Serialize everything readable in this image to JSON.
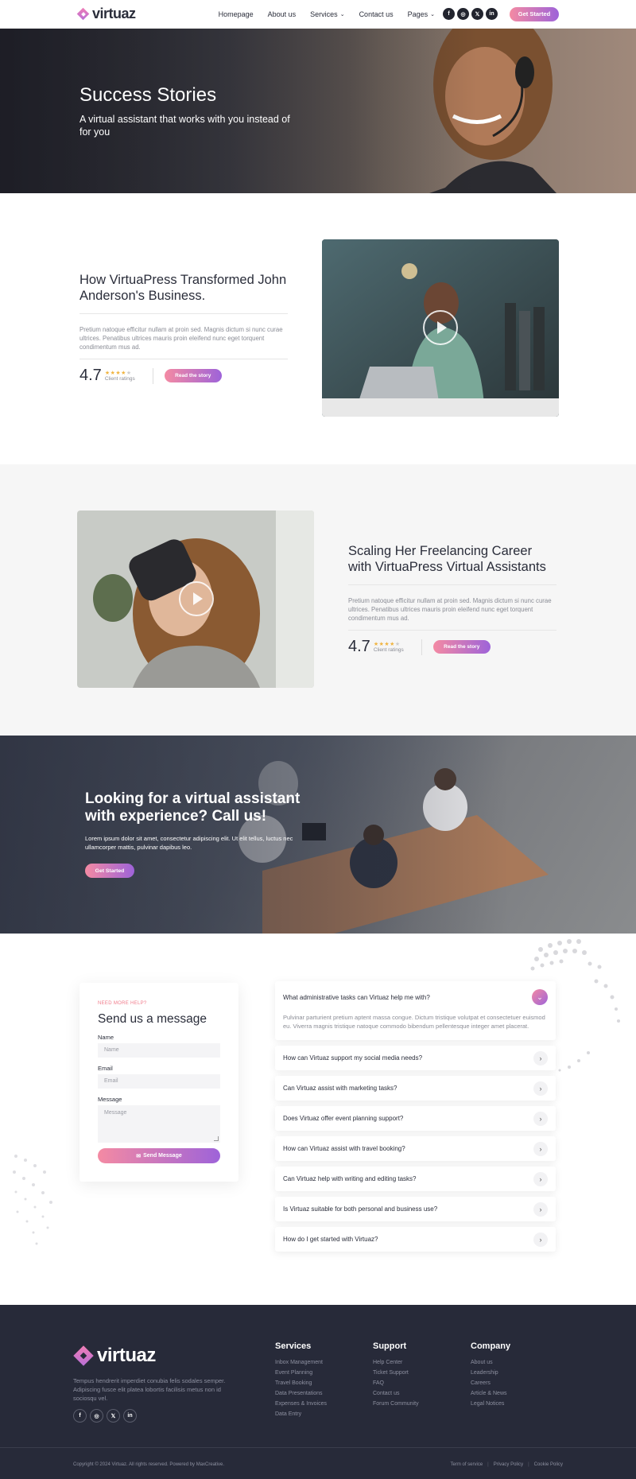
{
  "header": {
    "brand": "virtuaz",
    "nav": [
      {
        "label": "Homepage",
        "has_dropdown": false
      },
      {
        "label": "About us",
        "has_dropdown": false
      },
      {
        "label": "Services",
        "has_dropdown": true
      },
      {
        "label": "Contact us",
        "has_dropdown": false
      },
      {
        "label": "Pages",
        "has_dropdown": true
      }
    ],
    "socials": [
      "f",
      "◎",
      "𝕏",
      "in"
    ],
    "cta_label": "Get Started"
  },
  "hero": {
    "title": "Success Stories",
    "subtitle": "A virtual assistant that works with you instead of for you"
  },
  "stories": [
    {
      "title": "How VirtuaPress Transformed John Anderson's Business.",
      "body": "Pretium natoque efficitur nullam at proin sed. Magnis dictum si nunc curae ultrices. Penatibus ultrices mauris proin eleifend nunc eget torquent condimentum mus ad.",
      "rating": "4.7",
      "stars": "★★★★",
      "stars_off": "★",
      "rating_label": "Client ratings",
      "button": "Read the story"
    },
    {
      "title": "Scaling Her Freelancing Career with VirtuaPress Virtual Assistants",
      "body": "Pretium natoque efficitur nullam at proin sed. Magnis dictum si nunc curae ultrices. Penatibus ultrices mauris proin eleifend nunc eget torquent condimentum mus ad.",
      "rating": "4.7",
      "stars": "★★★★",
      "stars_off": "★",
      "rating_label": "Client ratings",
      "button": "Read the story"
    }
  ],
  "cta": {
    "title": "Looking for a virtual assistant with experience? Call us!",
    "body": "Lorem ipsum dolor sit amet, consectetur adipiscing elit. Ut elit tellus, luctus nec ullamcorper mattis, pulvinar dapibus leo.",
    "button": "Get Started"
  },
  "contact": {
    "eyebrow": "NEED MORE HELP?",
    "title": "Send us a message",
    "name_label": "Name",
    "name_placeholder": "Name",
    "email_label": "Email",
    "email_placeholder": "Email",
    "message_label": "Message",
    "message_placeholder": "Message",
    "submit": "Send Message",
    "submit_icon": "✉"
  },
  "faq": {
    "open": {
      "question": "What administrative tasks can Virtuaz help me with?",
      "answer": "Pulvinar parturient pretium aptent massa congue. Dictum tristique volutpat et consectetuer euismod eu. Viverra magnis tristique natoque commodo bibendum pellentesque integer amet placerat.",
      "icon": "⌄"
    },
    "items": [
      "How can Virtuaz support my social media needs?",
      "Can Virtuaz assist with marketing tasks?",
      "Does Virtuaz offer event planning support?",
      "How can Virtuaz assist with travel booking?",
      "Can Virtuaz help with writing and editing tasks?",
      "Is Virtuaz suitable for both personal and business use?",
      "How do I get started with Virtuaz?"
    ],
    "item_icon": "›"
  },
  "footer": {
    "brand": "virtuaz",
    "description": "Tempus hendrerit imperdiet conubia felis sodales semper. Adipiscing fusce elit platea lobortis facilisis metus non id sociosqu vel.",
    "socials": [
      "f",
      "◎",
      "𝕏",
      "in"
    ],
    "columns": [
      {
        "title": "Services",
        "links": [
          "Inbox Management",
          "Event Planning",
          "Travel Booking",
          "Data Presentations",
          "Expenses & Invoices",
          "Data Entry"
        ]
      },
      {
        "title": "Support",
        "links": [
          "Help Center",
          "Ticket Support",
          "FAQ",
          "Contact us",
          "Forum Community"
        ]
      },
      {
        "title": "Company",
        "links": [
          "About us",
          "Leadership",
          "Careers",
          "Article & News",
          "Legal Notices"
        ]
      }
    ],
    "copyright": "Copyright © 2024 Virtuaz. All rights reserved. Powered by MaxCreative.",
    "legal": [
      "Term of service",
      "Privacy Policy",
      "Cookie Policy"
    ]
  },
  "colors": {
    "accent_start": "#f48aa3",
    "accent_end": "#9e63d9",
    "footer_bg": "#272a39",
    "text_dark": "#2a2d3a"
  }
}
